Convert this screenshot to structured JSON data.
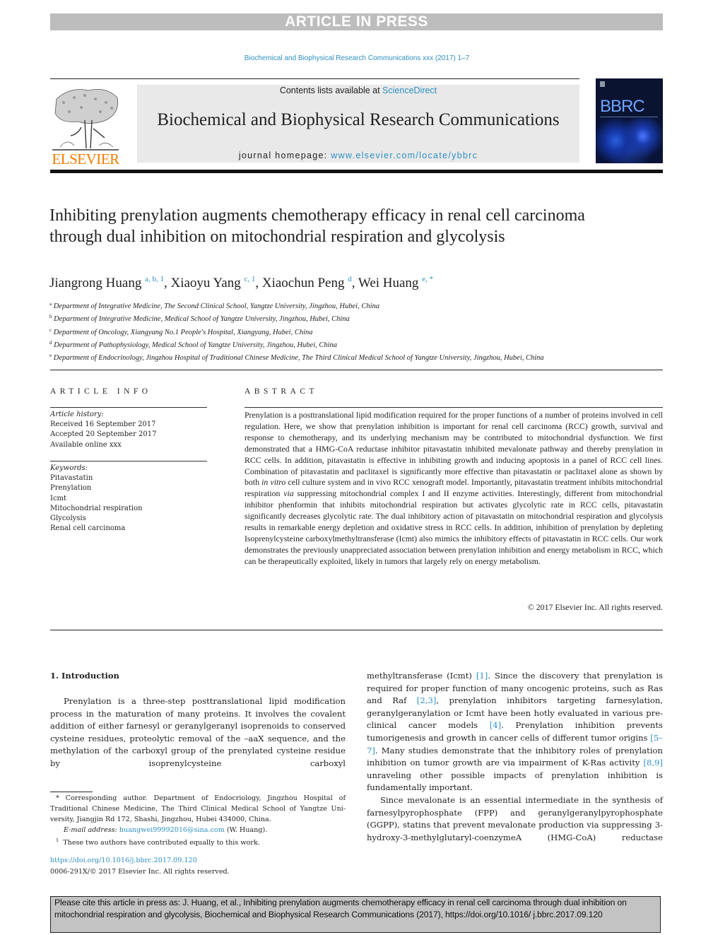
{
  "banner": {
    "text": "ARTICLE IN PRESS"
  },
  "journal_ref": "Biochemical and Biophysical Research Communications xxx (2017) 1–7",
  "masthead": {
    "publisher_logo_text": "ELSEVIER",
    "contents_prefix": "Contents lists available at ",
    "contents_link": "ScienceDirect",
    "journal_title": "Biochemical and Biophysical Research Communications",
    "homepage_prefix": "journal homepage: ",
    "homepage_link": "www.elsevier.com/locate/ybbrc",
    "cover_text": "BBRC"
  },
  "article": {
    "title": "Inhibiting prenylation augments chemotherapy efficacy in renal cell carcinoma through dual inhibition on mitochondrial respiration and glycolysis",
    "authors": [
      {
        "name": "Jiangrong Huang",
        "sup": "a, b, 1",
        "sep": ", "
      },
      {
        "name": "Xiaoyu Yang",
        "sup": "c, 1",
        "sep": ", "
      },
      {
        "name": "Xiaochun Peng",
        "sup": "d",
        "sep": ", "
      },
      {
        "name": "Wei Huang",
        "sup": "e, *",
        "sep": ""
      }
    ],
    "affiliations": [
      {
        "key": "a",
        "text": "Department of Integrative Medicine, The Second Clinical School, Yangtze University, Jingzhou, Hubei, China"
      },
      {
        "key": "b",
        "text": "Department of Integrative Medicine, Medical School of Yangtze University, Jingzhou, Hubei, China"
      },
      {
        "key": "c",
        "text": "Department of Oncology, Xiangyang No.1 People's Hospital, Xiangyang, Hubei, China"
      },
      {
        "key": "d",
        "text": "Department of Pathophysiology, Medical School of Yangtze University, Jingzhou, Hubei, China"
      },
      {
        "key": "e",
        "text": "Department of Endocrinology, Jingzhou Hospital of Traditional Chinese Medicine, The Third Clinical Medical School of Yangtze University, Jingzhou, Hubei, China"
      }
    ]
  },
  "article_info": {
    "heading": "ARTICLE INFO",
    "history_label": "Article history:",
    "history": [
      "Received 16 September 2017",
      "Accepted 20 September 2017",
      "Available online xxx"
    ],
    "keywords_label": "Keywords:",
    "keywords": [
      "Pitavastatin",
      "Prenylation",
      "Icmt",
      "Mitochondrial respiration",
      "Glycolysis",
      "Renal cell carcinoma"
    ]
  },
  "abstract": {
    "heading": "ABSTRACT",
    "part1": "Prenylation is a posttranslational lipid modification required for the proper functions of a number of proteins involved in cell regulation. Here, we show that prenylation inhibition is important for renal cell carcinoma (RCC) growth, survival and response to chemotherapy, and its underlying mechanism may be contributed to mitochondrial dysfunction. We first demonstrated that a HMG-CoA reductase inhibitor pitavastatin inhibited mevalonate pathway and thereby prenylation in RCC cells. In addition, pitavastatin is effective in inhibiting growth and inducing apoptosis in a panel of RCC cell lines. Combination of pitavastatin and paclitaxel is significantly more effective than pitavastatin or paclitaxel alone as shown by both ",
    "italic1": "in vitro",
    "part2": " cell culture system and in vivo RCC xenograft model. Importantly, pitavastatin treatment inhibits mitochondrial respiration ",
    "italic2": "via",
    "part3": " suppressing mitochondrial complex I and II enzyme activities. Interestingly, different from mitochondrial inhibitor phenformin that inhibits mitochondrial respiration but activates glycolytic rate in RCC cells, pitavastatin significantly decreases glycolytic rate. The dual inhibitory action of pitavastatin on mitochondrial respiration and glycolysis results in remarkable energy depletion and oxidative stress in RCC cells. In addition, inhibition of prenylation by depleting Isoprenylcysteine carboxylmethyltransferase (Icmt) also mimics the inhibitory effects of pitavastatin in RCC cells. Our work demonstrates the previously unappreciated association between prenylation inhibition and energy metabolism in RCC, which can be therapeutically exploited, likely in tumors that largely rely on energy metabolism.",
    "copyright": "© 2017 Elsevier Inc. All rights reserved."
  },
  "introduction": {
    "heading": "1.  Introduction",
    "left_para": "Prenylation is a three-step posttranslational lipid modification process in the maturation of many proteins. It involves the covalent addition of either farnesyl or geranylgeranyl isoprenoids to conserved cysteine residues, proteolytic removal of the –aaX sequence, and the methylation of the carboxyl group of the pre­nylated cysteine residue by isoprenylcysteine carboxyl",
    "right_p1": [
      {
        "t": "methyltransferase (Icmt) "
      },
      {
        "ref": "[1]"
      },
      {
        "t": ". Since the discovery that prenylation is required for proper function of many oncogenic proteins, such as Ras and Raf "
      },
      {
        "ref": "[2,3]"
      },
      {
        "t": ", prenylation inhibitors targeting farnesylation, geranylgeranylation or Icmt have been hotly evaluated in various pre-clinical cancer models "
      },
      {
        "ref": "[4]"
      },
      {
        "t": ". Prenylation inhibition prevents tumorigenesis and growth in cancer cells of different tumor origins "
      },
      {
        "ref": "[5–7]"
      },
      {
        "t": ". Many studies demonstrate that the inhibitory roles of pre­nylation inhibition on tumor growth are via impairment of K-Ras activity "
      },
      {
        "ref": "[8,9]"
      },
      {
        "t": " unraveling other possible impacts of prenylation in­hibition is fundamentally important."
      }
    ],
    "right_p2": "Since mevalonate is an essential intermediate in the synthesis of farnesylpyrophosphate (FPP) and geranylgeranylpyrophosphate (GGPP), statins that prevent mevalonate production via suppress­ing 3-hydroxy-3-methylglutaryl-coenzymeA (HMG-CoA) reductase"
  },
  "footnotes": {
    "corresponding": "* Corresponding author. Department of Endocriology, Jingzhou Hospital of Traditional Chinese Medicine, The Third Clinical Medical School of Yangtze Uni­versity, Jiangjin Rd 172, Shashi, Jingzhou, Hubei 434000, China.",
    "email_label": "E-mail address:",
    "email": "huangwei99992016@sina.com",
    "email_suffix": " (W. Huang).",
    "equal_sup": "1",
    "equal_text": "These two authors have contributed equally to this work.",
    "doi": "https://doi.org/10.1016/j.bbrc.2017.09.120",
    "issn": "0006-291X/© 2017 Elsevier Inc. All rights reserved."
  },
  "cite_box": {
    "text": "Please cite this article in press as: J. Huang, et al., Inhibiting prenylation augments chemotherapy efficacy in renal cell carcinoma through dual inhibition on mitochondrial respiration and glycolysis, Biochemical and Biophysical Research Communications (2017), https://doi.org/10.1016/ j.bbrc.2017.09.120"
  }
}
